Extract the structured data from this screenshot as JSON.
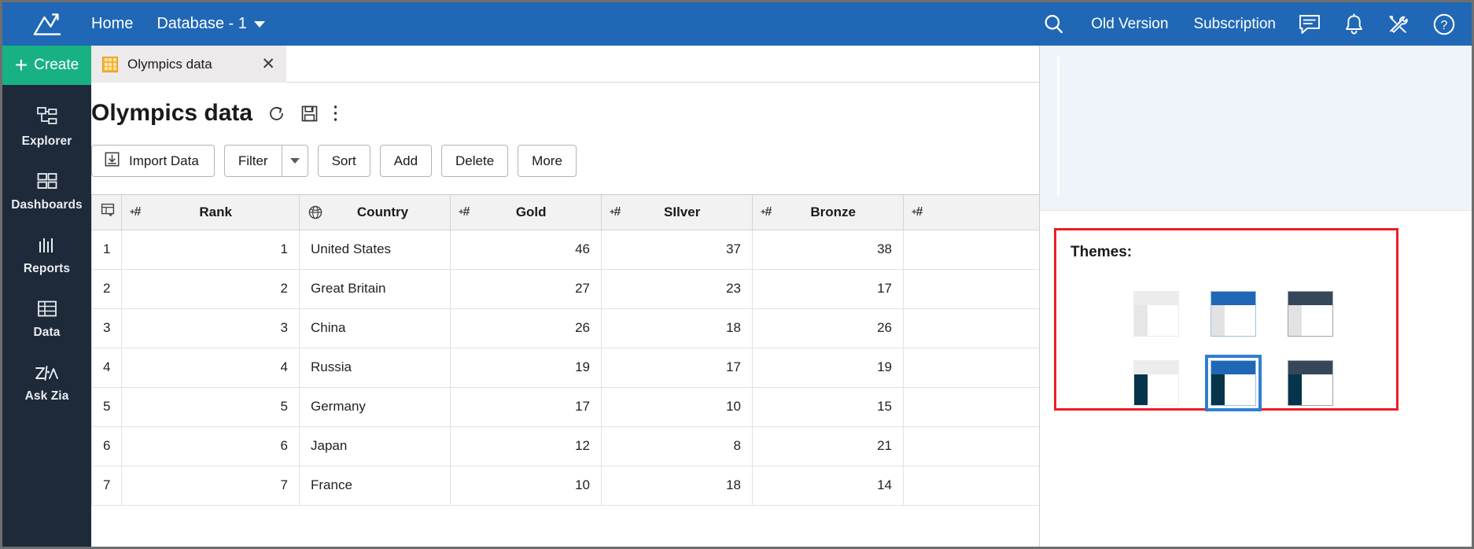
{
  "topbar": {
    "logo_icon": "zoho-analytics-logo-icon",
    "home_label": "Home",
    "database_label": "Database - 1",
    "search_icon": "search-icon",
    "old_version_label": "Old Version",
    "subscription_label": "Subscription",
    "chat_icon": "chat-icon",
    "bell_icon": "bell-icon",
    "tools_icon": "tools-icon",
    "help_icon": "help-icon",
    "bg_color": "#2068b5"
  },
  "sidebar": {
    "create_label": "Create",
    "create_color": "#18b184",
    "bg_color": "#1e2a3a",
    "items": [
      {
        "label": "Explorer",
        "icon": "explorer-icon"
      },
      {
        "label": "Dashboards",
        "icon": "dashboards-icon"
      },
      {
        "label": "Reports",
        "icon": "reports-icon"
      },
      {
        "label": "Data",
        "icon": "data-icon"
      },
      {
        "label": "Ask Zia",
        "icon": "ask-zia-icon"
      }
    ]
  },
  "tab": {
    "title": "Olympics data",
    "icon": "table-grid-icon",
    "close_icon": "close-icon"
  },
  "workspace": {
    "title": "Olympics data",
    "refresh_icon": "refresh-icon",
    "save_icon": "save-icon",
    "more_icon": "more-vertical-icon",
    "toolbar": {
      "import_label": "Import Data",
      "import_icon": "import-download-icon",
      "filter_label": "Filter",
      "filter_caret_icon": "chevron-down-icon",
      "sort_label": "Sort",
      "add_label": "Add",
      "delete_label": "Delete",
      "more_label": "More"
    }
  },
  "table": {
    "row_header_icon": "column-settings-icon",
    "columns": [
      {
        "name": "Rank",
        "type_icon": "number-type-icon",
        "align": "num"
      },
      {
        "name": "Country",
        "type_icon": "geo-globe-icon",
        "align": "txt"
      },
      {
        "name": "Gold",
        "type_icon": "number-type-icon",
        "align": "num"
      },
      {
        "name": "SIlver",
        "type_icon": "number-type-icon",
        "align": "num"
      },
      {
        "name": "Bronze",
        "type_icon": "number-type-icon",
        "align": "num"
      },
      {
        "name": "",
        "type_icon": "number-type-icon",
        "align": "num"
      }
    ],
    "rows": [
      {
        "idx": "1",
        "cells": [
          "1",
          "United States",
          "46",
          "37",
          "38",
          ""
        ]
      },
      {
        "idx": "2",
        "cells": [
          "2",
          "Great Britain",
          "27",
          "23",
          "17",
          ""
        ]
      },
      {
        "idx": "3",
        "cells": [
          "3",
          "China",
          "26",
          "18",
          "26",
          ""
        ]
      },
      {
        "idx": "4",
        "cells": [
          "4",
          "Russia",
          "19",
          "17",
          "19",
          ""
        ]
      },
      {
        "idx": "5",
        "cells": [
          "5",
          "Germany",
          "17",
          "10",
          "15",
          ""
        ]
      },
      {
        "idx": "6",
        "cells": [
          "6",
          "Japan",
          "12",
          "8",
          "21",
          ""
        ]
      },
      {
        "idx": "7",
        "cells": [
          "7",
          "France",
          "10",
          "18",
          "14",
          ""
        ]
      }
    ]
  },
  "right_panel": {
    "themes_label": "Themes:",
    "highlight_color": "#ee1c24",
    "selected_index": 4,
    "themes": [
      {
        "name": "light-plain",
        "header": "#ececec",
        "sidebar": "#e6e6e6",
        "border": "#ececec",
        "selected": false
      },
      {
        "name": "blue-light",
        "header": "#2068b5",
        "sidebar": "#e2e2e2",
        "border": "#9dbfe2",
        "selected": false
      },
      {
        "name": "dark-slate-light",
        "header": "#37475a",
        "sidebar": "#e2e2e2",
        "border": "#9aa3ad",
        "selected": false
      },
      {
        "name": "light-navy",
        "header": "#ececec",
        "sidebar": "#06344a",
        "border": "#ececec",
        "selected": false
      },
      {
        "name": "blue-navy",
        "header": "#2068b5",
        "sidebar": "#06344a",
        "border": "#9dbfe2",
        "selected": true
      },
      {
        "name": "dark-slate-navy",
        "header": "#37475a",
        "sidebar": "#06344a",
        "border": "#9aa3ad",
        "selected": false
      }
    ]
  }
}
